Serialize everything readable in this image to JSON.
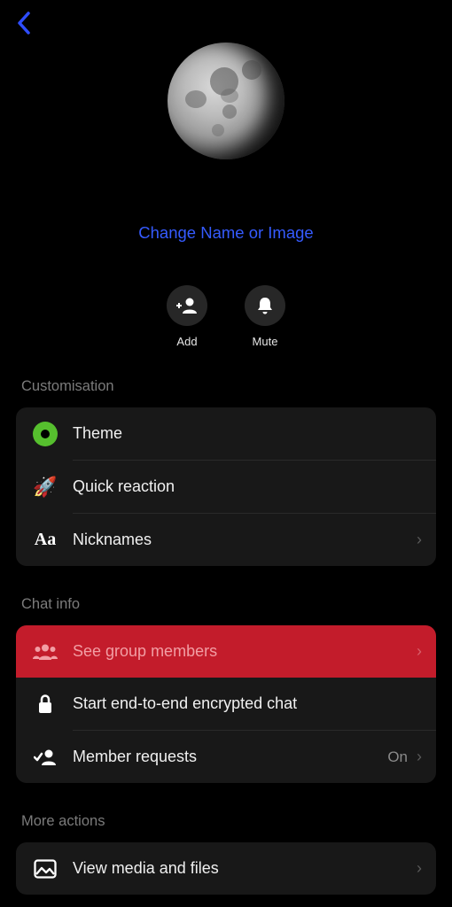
{
  "header": {
    "change_link": "Change Name or Image"
  },
  "actions": {
    "add": "Add",
    "mute": "Mute"
  },
  "sections": {
    "customisation": {
      "title": "Customisation",
      "theme": "Theme",
      "quick_reaction": "Quick reaction",
      "nicknames": "Nicknames"
    },
    "chat_info": {
      "title": "Chat info",
      "see_members": "See group members",
      "encrypted": "Start end-to-end encrypted chat",
      "member_requests": "Member requests",
      "member_requests_value": "On"
    },
    "more_actions": {
      "title": "More actions",
      "view_media": "View media and files"
    }
  }
}
